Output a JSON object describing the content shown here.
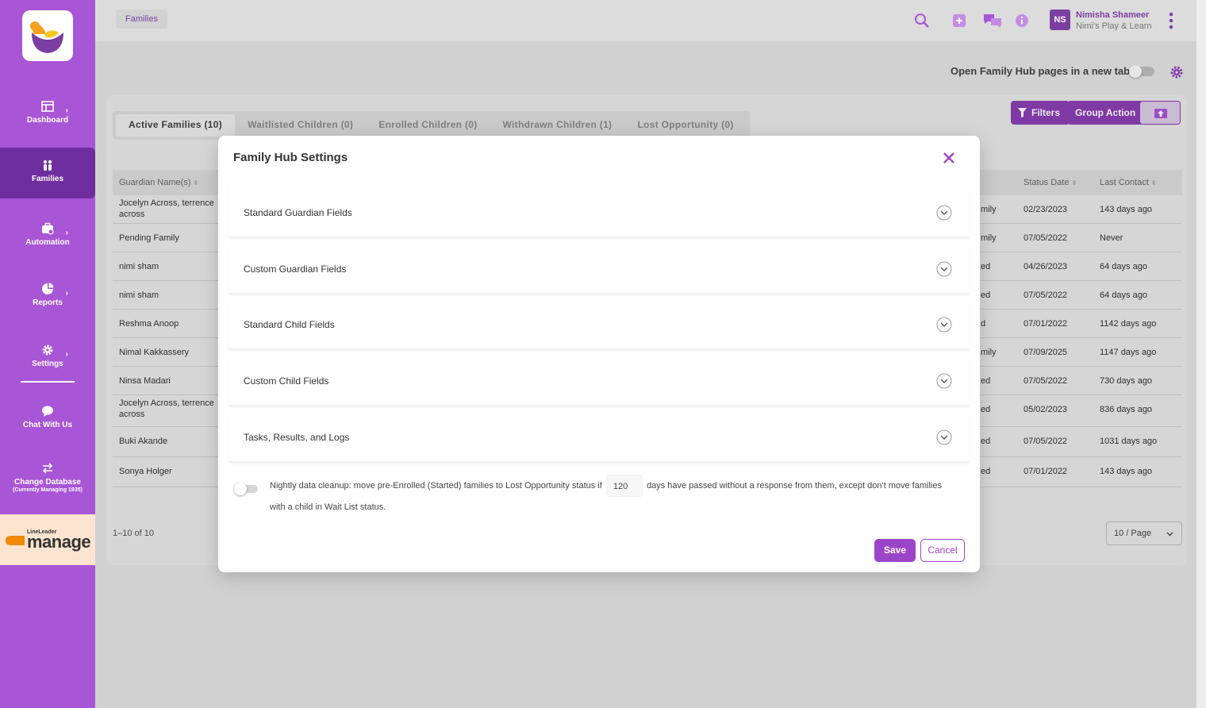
{
  "sidebar": {
    "items": [
      {
        "label": "Dashboard"
      },
      {
        "label": "Families"
      },
      {
        "label": "Automation"
      },
      {
        "label": "Reports"
      },
      {
        "label": "Settings"
      },
      {
        "label": "Chat With Us"
      },
      {
        "label": "Change Database",
        "sub": "(Currently Managing 1935)"
      }
    ],
    "brand_small": "LineLeader",
    "brand_big": "manage"
  },
  "topbar": {
    "breadcrumb": "Families",
    "user_initials": "NS",
    "user_name": "Nimisha Shameer",
    "user_org": "Nimi's Play & Learn"
  },
  "page": {
    "newtab_label": "Open Family Hub pages in a new tab",
    "tabs": [
      {
        "label": "Active Families (10)"
      },
      {
        "label": "Waitlisted Children (0)"
      },
      {
        "label": "Enrolled Children (0)"
      },
      {
        "label": "Withdrawn Children (1)"
      },
      {
        "label": "Lost Opportunity (0)"
      }
    ],
    "filters_label": "Filters",
    "group_action_label": "Group Action",
    "columns": {
      "guardian": "Guardian Name(s)",
      "status_date": "Status Date",
      "last_contact": "Last Contact"
    },
    "rows": [
      {
        "guardian": "Jocelyn Across, terrence",
        "guardian2": "across",
        "status": "mily",
        "date": "02/23/2023",
        "contact": "143 days ago"
      },
      {
        "guardian": "Pending Family",
        "guardian2": "",
        "status": "mily",
        "date": "07/05/2022",
        "contact": "Never"
      },
      {
        "guardian": "nimi sham",
        "guardian2": "",
        "status": "ed",
        "date": "04/26/2023",
        "contact": "64 days ago"
      },
      {
        "guardian": "nimi sham",
        "guardian2": "",
        "status": "ed",
        "date": "07/05/2022",
        "contact": "64 days ago"
      },
      {
        "guardian": "Reshma Anoop",
        "guardian2": "",
        "status": "d",
        "date": "07/01/2022",
        "contact": "1142 days ago"
      },
      {
        "guardian": "Nimal Kakkassery",
        "guardian2": "",
        "status": "mily",
        "date": "07/09/2025",
        "contact": "1147 days ago"
      },
      {
        "guardian": "Ninsa Madari",
        "guardian2": "",
        "status": "ed",
        "date": "07/05/2022",
        "contact": "730 days ago"
      },
      {
        "guardian": "Jocelyn Across, terrence",
        "guardian2": "across",
        "status": "ed",
        "date": "05/02/2023",
        "contact": "836 days ago"
      },
      {
        "guardian": "Buki Akande",
        "guardian2": "",
        "status": "ed",
        "date": "07/05/2022",
        "contact": "1031 days ago"
      },
      {
        "guardian": "Sonya Holger",
        "guardian2": "",
        "status": "ed",
        "date": "07/01/2022",
        "contact": "143 days ago"
      }
    ],
    "pager_range": "1–10 of 10",
    "page_size": "10 / Page"
  },
  "modal": {
    "title": "Family Hub Settings",
    "sections": [
      {
        "label": "Standard Guardian Fields"
      },
      {
        "label": "Custom Guardian Fields"
      },
      {
        "label": "Standard Child Fields"
      },
      {
        "label": "Custom Child Fields"
      },
      {
        "label": "Tasks, Results, and Logs"
      }
    ],
    "cleanup_before": "Nightly data cleanup: move pre-Enrolled (Started) families to Lost Opportunity status if",
    "cleanup_days": "120",
    "cleanup_after": "days have passed without a response from them, except don't move families with a child in Wait List status.",
    "save_label": "Save",
    "cancel_label": "Cancel"
  },
  "colors": {
    "accent": "#a855d6",
    "accent_dark": "#7a3fa0",
    "button": "#9b45c9"
  }
}
